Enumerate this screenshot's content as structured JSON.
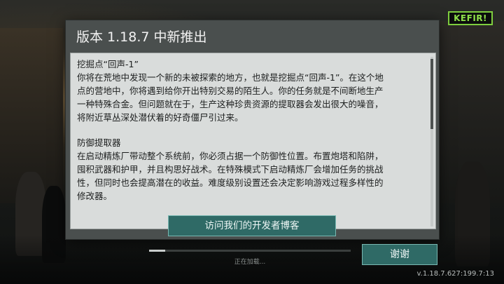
{
  "brand": {
    "logo_text": "KEFIR!",
    "logo_color": "#8fe04a"
  },
  "dialog": {
    "title": "版本 1.18.7 中新推出",
    "sections": [
      {
        "heading": "挖掘点“回声-1”",
        "lines": [
          "你将在荒地中发现一个新的未被探索的地方，也就是挖掘点“回声-1”。在这个地",
          "点的营地中，你将遇到给你开出特别交易的陌生人。你的任务就是不间断地生产",
          "一种特殊合金。但问题就在于，生产这种珍贵资源的提取器会发出很大的噪音，",
          "将附近草丛深处潜伏着的好奇僵尸引过来。"
        ]
      },
      {
        "heading": "防御提取器",
        "lines": [
          "在启动精炼厂带动整个系统前，你必须占据一个防御性位置。布置炮塔和陷阱，",
          "囤积武器和护甲，并且构思好战术。在特殊模式下启动精炼厂会增加任务的挑战",
          "性，但同时也会提高潜在的收益。难度级别设置还会决定影响游戏过程多样性的",
          "修改器。"
        ]
      }
    ],
    "blog_button": "访问我们的开发者博客"
  },
  "footer": {
    "progress": 0.08,
    "loading_text": "正在加载...",
    "ok_button": "谢谢",
    "version": "v.1.18.7.627:199.7:13"
  },
  "colors": {
    "accent_button": "#2f6a66",
    "dialog_bg": "#4a4f4e",
    "notes_bg": "#d9dcdb"
  }
}
